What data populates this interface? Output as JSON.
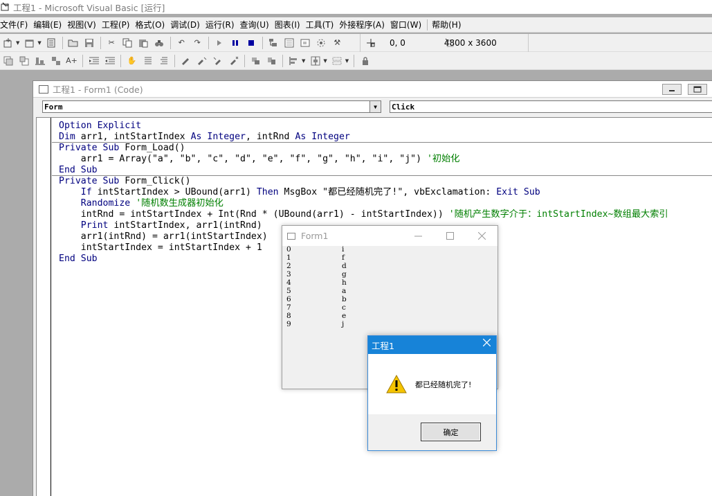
{
  "window": {
    "title": "工程1 - Microsoft Visual Basic [运行]"
  },
  "menu": [
    "文件(F)",
    "编辑(E)",
    "视图(V)",
    "工程(P)",
    "格式(O)",
    "调试(D)",
    "运行(R)",
    "查询(U)",
    "图表(I)",
    "工具(T)",
    "外接程序(A)",
    "窗口(W)"
  ],
  "menu_help": "帮助(H)",
  "toolbar": {
    "position": "0, 0",
    "size": "4800 x 3600"
  },
  "code_window": {
    "title": "工程1 - Form1 (Code)",
    "object_combo": "Form",
    "proc_combo": "Click",
    "lines": [
      [
        {
          "t": "Option Explicit",
          "c": "kw"
        }
      ],
      [
        {
          "t": "Dim",
          "c": "kw"
        },
        {
          "t": " arr1, intStartIndex ",
          "c": "tx"
        },
        {
          "t": "As Integer",
          "c": "kw"
        },
        {
          "t": ", intRnd ",
          "c": "tx"
        },
        {
          "t": "As Integer",
          "c": "kw"
        }
      ],
      [
        {
          "t": "Private Sub",
          "c": "kw"
        },
        {
          "t": " Form_Load()",
          "c": "tx"
        }
      ],
      [
        {
          "t": "    arr1 = Array(\"a\", \"b\", \"c\", \"d\", \"e\", \"f\", \"g\", \"h\", \"i\", \"j\") ",
          "c": "tx"
        },
        {
          "t": "'初始化",
          "c": "cm"
        }
      ],
      [
        {
          "t": "End Sub",
          "c": "kw"
        }
      ],
      [
        {
          "t": "Private Sub",
          "c": "kw"
        },
        {
          "t": " Form_Click()",
          "c": "tx"
        }
      ],
      [
        {
          "t": "    ",
          "c": "tx"
        },
        {
          "t": "If",
          "c": "kw"
        },
        {
          "t": " intStartIndex > UBound(arr1) ",
          "c": "tx"
        },
        {
          "t": "Then",
          "c": "kw"
        },
        {
          "t": " MsgBox \"都已经随机完了!\", vbExclamation: ",
          "c": "tx"
        },
        {
          "t": "Exit Sub",
          "c": "kw"
        }
      ],
      [
        {
          "t": "    ",
          "c": "tx"
        },
        {
          "t": "Randomize",
          "c": "kw"
        },
        {
          "t": " ",
          "c": "tx"
        },
        {
          "t": "'随机数生成器初始化",
          "c": "cm"
        }
      ],
      [
        {
          "t": "    intRnd = intStartIndex + Int(Rnd * (UBound(arr1) - intStartIndex)) ",
          "c": "tx"
        },
        {
          "t": "'随机产生数字介于：intStartIndex~数组最大索引",
          "c": "cm"
        }
      ],
      [
        {
          "t": "    ",
          "c": "tx"
        },
        {
          "t": "Print",
          "c": "kw"
        },
        {
          "t": " intStartIndex, arr1(intRnd)",
          "c": "tx"
        }
      ],
      [
        {
          "t": "    arr1(intRnd) = arr1(intStartIndex)",
          "c": "tx"
        }
      ],
      [
        {
          "t": "    intStartIndex = intStartIndex + 1",
          "c": "tx"
        }
      ],
      [
        {
          "t": "End Sub",
          "c": "kw"
        }
      ]
    ]
  },
  "form1": {
    "title": "Form1",
    "output": [
      [
        "0",
        "i"
      ],
      [
        "1",
        "f"
      ],
      [
        "2",
        "d"
      ],
      [
        "3",
        "g"
      ],
      [
        "4",
        "h"
      ],
      [
        "5",
        "a"
      ],
      [
        "6",
        "b"
      ],
      [
        "7",
        "c"
      ],
      [
        "8",
        "e"
      ],
      [
        "9",
        "j"
      ]
    ]
  },
  "msgbox": {
    "title": "工程1",
    "message": "都已经随机完了!",
    "ok_label": "确定"
  },
  "colors": {
    "keyword": "#00007f",
    "comment": "#007f00",
    "msgbox_title": "#1783d8"
  }
}
